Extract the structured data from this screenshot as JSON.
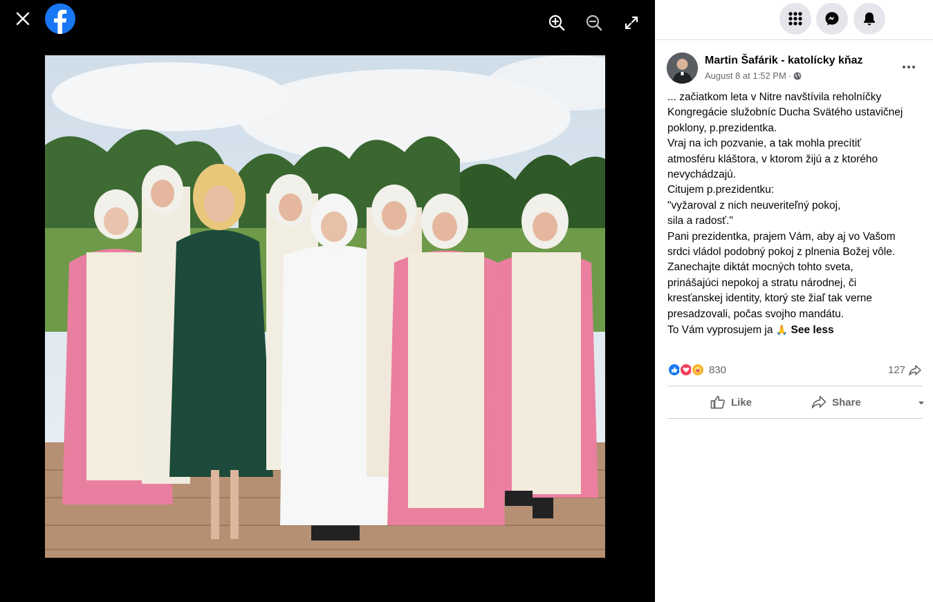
{
  "viewer": {
    "close_icon": "close-icon",
    "logo": "facebook-logo",
    "zoom_in_icon": "zoom-in-icon",
    "zoom_out_icon": "zoom-out-icon",
    "fullscreen_icon": "fullscreen-icon",
    "photo_alt": "Photo of a woman in a green dress standing with nuns in pink and white habits"
  },
  "topbar": {
    "menu_icon": "grid-menu-icon",
    "messenger_icon": "messenger-icon",
    "notifications_icon": "bell-icon"
  },
  "post": {
    "author": "Martin Šafárik - katolícky kňaz",
    "timestamp": "August 8 at 1:52 PM",
    "separator": "·",
    "audience_icon": "globe-icon",
    "lines": [
      "... začiatkom leta v Nitre navštívila reholníčky",
      "Kongregácie služobníc Ducha Svätého ustavičnej",
      "poklony, p.prezidentka.",
      "Vraj na ich pozvanie, a tak mohla precítiť",
      "atmosféru kláštora, v ktorom žijú a z ktorého",
      "nevychádzajú.",
      "Citujem p.prezidentku:",
      "\"vyžaroval z nich neuveriteľný pokoj,",
      "sila a radosť.\"",
      "Pani prezidentka, prajem Vám, aby aj vo Vašom",
      "srdci vládol podobný pokoj z plnenia Božej vôle.",
      "Zanechajte diktát mocných tohto sveta,",
      "prinášajúci nepokoj a stratu národnej, či",
      "kresťanskej identity, ktorý ste žiaľ tak verne",
      "presadzovali, počas svojho mandátu."
    ],
    "last_line": "To Vám vyprosujem ja",
    "emoji": "🙏",
    "see_less": "See less",
    "reaction_count": "830",
    "share_count": "127",
    "like_label": "Like",
    "share_label": "Share"
  }
}
